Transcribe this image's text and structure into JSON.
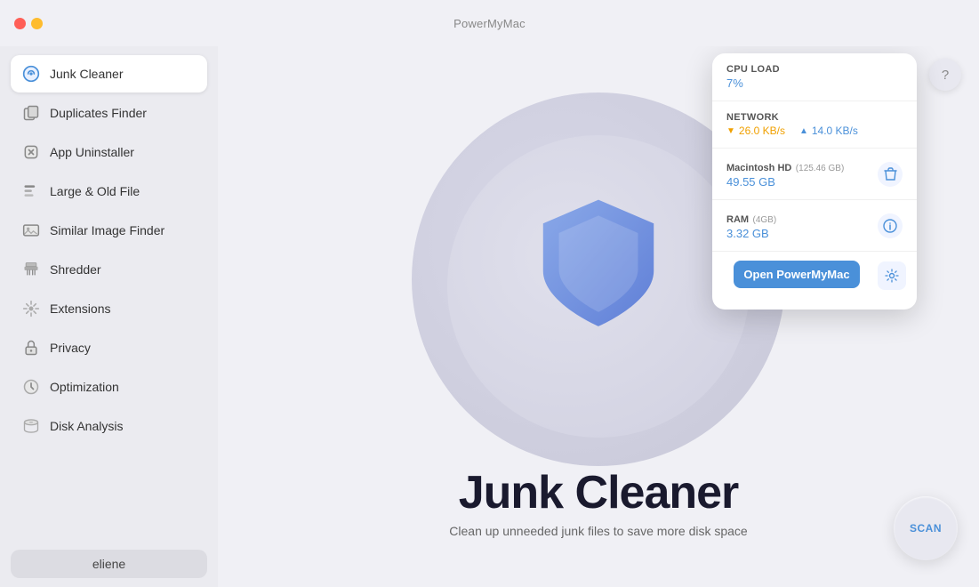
{
  "titlebar": {
    "app_name": "PowerMyMac"
  },
  "sidebar": {
    "items": [
      {
        "id": "junk-cleaner",
        "label": "Junk Cleaner",
        "active": true
      },
      {
        "id": "duplicates-finder",
        "label": "Duplicates Finder",
        "active": false
      },
      {
        "id": "app-uninstaller",
        "label": "App Uninstaller",
        "active": false
      },
      {
        "id": "large-old-file",
        "label": "Large & Old File",
        "active": false
      },
      {
        "id": "similar-image-finder",
        "label": "Similar Image Finder",
        "active": false
      },
      {
        "id": "shredder",
        "label": "Shredder",
        "active": false
      },
      {
        "id": "extensions",
        "label": "Extensions",
        "active": false
      },
      {
        "id": "privacy",
        "label": "Privacy",
        "active": false
      },
      {
        "id": "optimization",
        "label": "Optimization",
        "active": false
      },
      {
        "id": "disk-analysis",
        "label": "Disk Analysis",
        "active": false
      }
    ],
    "user": "eliene"
  },
  "content": {
    "title": "Junk Cleaner",
    "subtitle": "Clean up unneeded junk files to save more disk space",
    "scan_label": "SCAN"
  },
  "popup": {
    "cpu": {
      "label": "CPU LOAD",
      "value": "7%"
    },
    "network": {
      "label": "Network",
      "download": "26.0 KB/s",
      "upload": "14.0 KB/s"
    },
    "disk": {
      "name": "Macintosh HD",
      "size": "(125.46 GB)",
      "value": "49.55 GB"
    },
    "ram": {
      "label": "RAM",
      "size": "(4GB)",
      "value": "3.32 GB"
    },
    "open_btn": "Open PowerMyMac"
  },
  "help": {
    "label": "?"
  }
}
